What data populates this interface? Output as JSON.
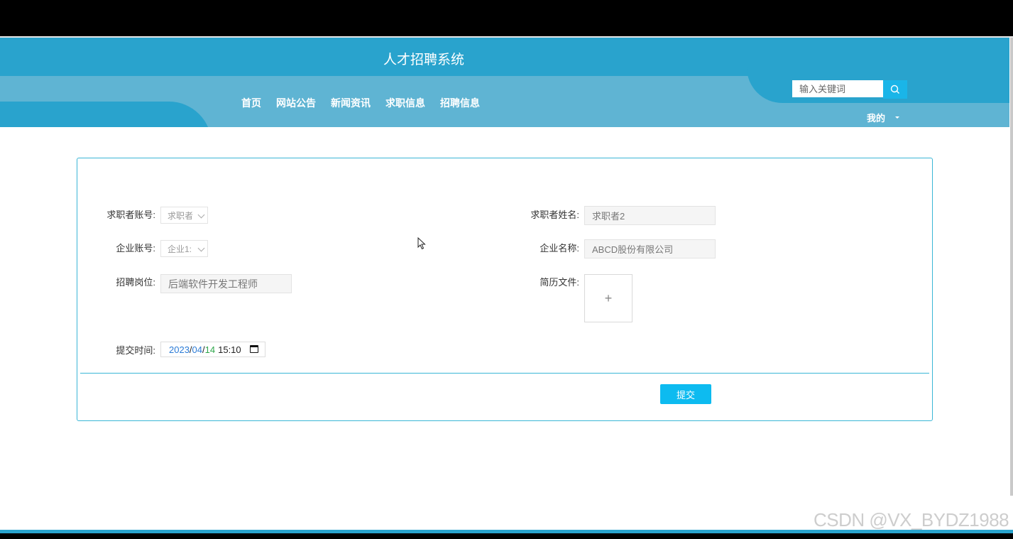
{
  "header": {
    "site_title": "人才招聘系统",
    "nav": [
      "首页",
      "网站公告",
      "新闻资讯",
      "求职信息",
      "招聘信息"
    ],
    "search_placeholder": "输入关键词",
    "user_menu": "我的"
  },
  "form": {
    "seeker_account_label": "求职者账号:",
    "seeker_account_value": "求职者",
    "seeker_name_label": "求职者姓名:",
    "seeker_name_value": "求职者2",
    "company_account_label": "企业账号:",
    "company_account_value": "企业1:",
    "company_name_label": "企业名称:",
    "company_name_value": "ABCD股份有限公司",
    "position_label": "招聘岗位:",
    "position_value": "后端软件开发工程师",
    "resume_label": "简历文件:",
    "upload_glyph": "+",
    "submit_time_label": "提交时间:",
    "submit_time": {
      "year": "2023",
      "month": "04",
      "day": "14",
      "time": "15:10"
    },
    "submit_button": "提交"
  },
  "watermark": "CSDN @VX_BYDZ1988",
  "colors": {
    "header": "#29a3cd",
    "band": "#5fb4d3",
    "accent": "#0dbbf0",
    "border": "#3ab6d6"
  }
}
